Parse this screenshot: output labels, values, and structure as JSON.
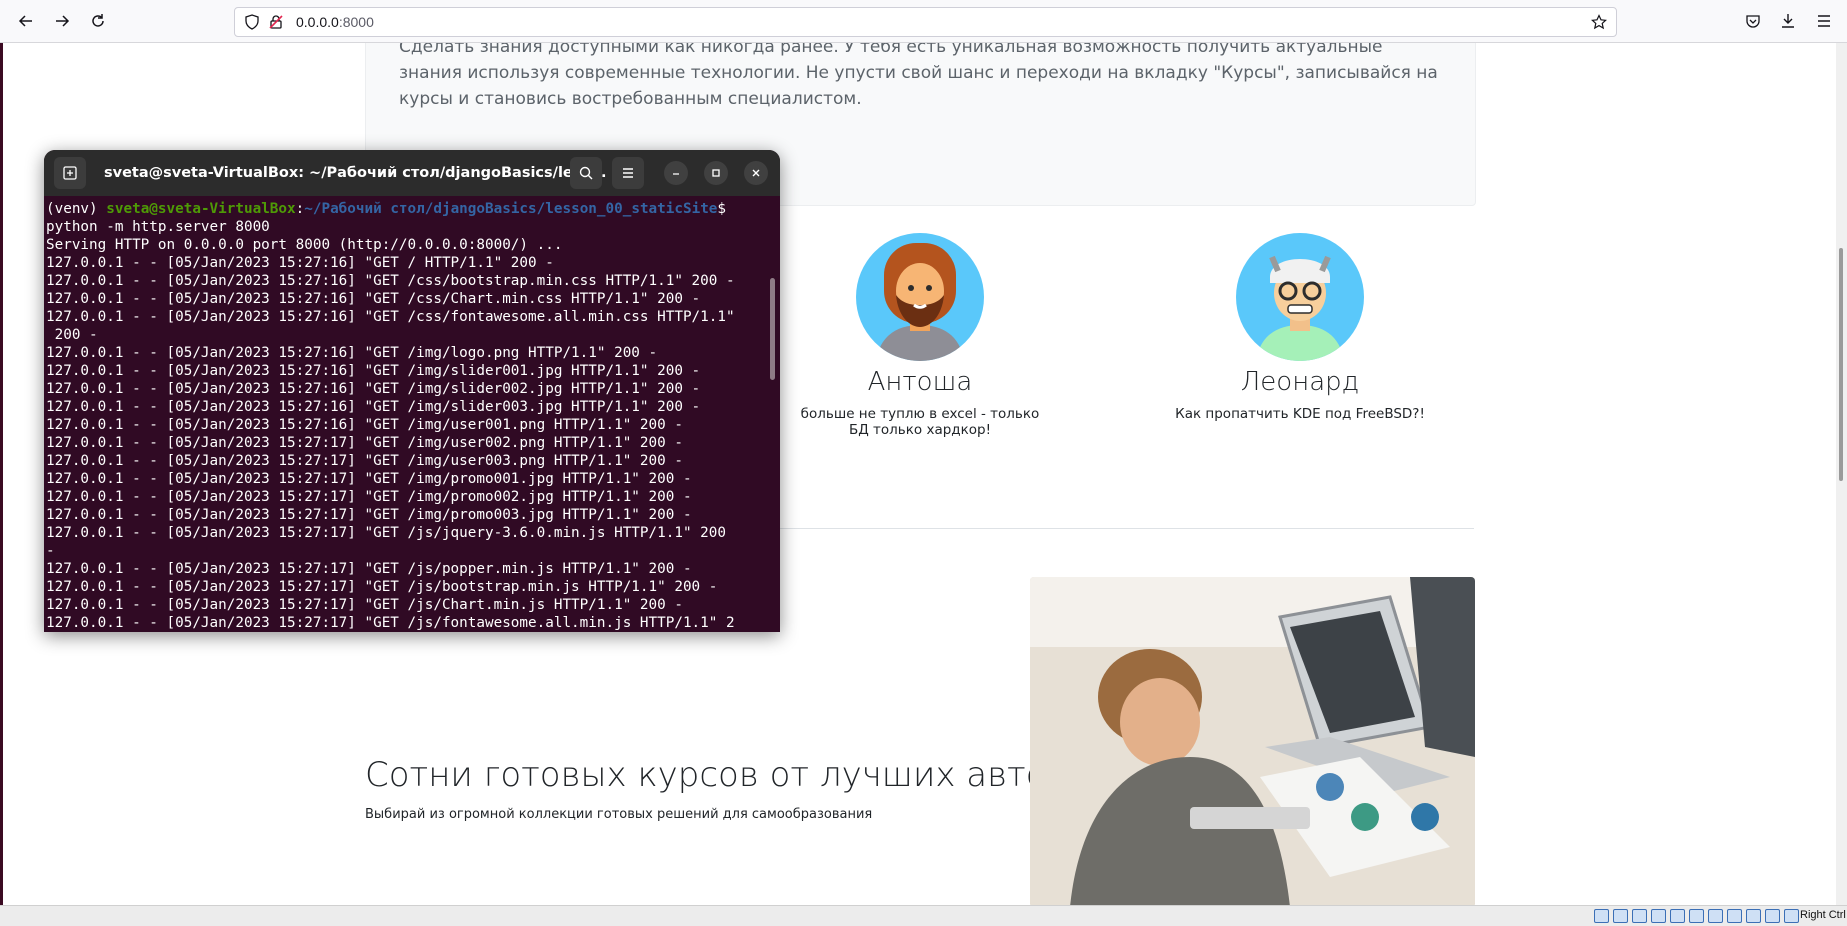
{
  "browser": {
    "url_host": "0.0.0.0",
    "url_port": ":8000"
  },
  "page": {
    "about_text": "Сделать знания доступными как никогда ранее. У тебя есть уникальная возможность получить актуальные знания используя современные технологии. Не упусти свой шанс и переходи на вкладку \"Курсы\", записывайся на курсы и становись востребованным специалистом.",
    "team": [
      {
        "name": "Антоша",
        "quote": "больше не туплю в excel - только БД только хардкор!"
      },
      {
        "name": "Леонард",
        "quote": "Как пропатчить KDE под FreeBSD?!"
      }
    ],
    "promo_title": "Сотни готовых курсов от лучших авторов",
    "promo_subtitle": "Выбирай из огромной коллекции готовых решений для самообразования"
  },
  "terminal": {
    "title": "sveta@sveta-VirtualBox: ~/Рабочий стол/djangoBasics/less...",
    "prompt_venv": "(venv) ",
    "prompt_user": "sveta@sveta-VirtualBox",
    "prompt_sep": ":",
    "prompt_path": "~/Рабочий стол/djangoBasics/lesson_00_staticSite",
    "prompt_end": "$",
    "lines": [
      "python -m http.server 8000",
      "Serving HTTP on 0.0.0.0 port 8000 (http://0.0.0.0:8000/) ...",
      "127.0.0.1 - - [05/Jan/2023 15:27:16] \"GET / HTTP/1.1\" 200 -",
      "127.0.0.1 - - [05/Jan/2023 15:27:16] \"GET /css/bootstrap.min.css HTTP/1.1\" 200 -",
      "127.0.0.1 - - [05/Jan/2023 15:27:16] \"GET /css/Chart.min.css HTTP/1.1\" 200 -",
      "127.0.0.1 - - [05/Jan/2023 15:27:16] \"GET /css/fontawesome.all.min.css HTTP/1.1\"",
      " 200 -",
      "127.0.0.1 - - [05/Jan/2023 15:27:16] \"GET /img/logo.png HTTP/1.1\" 200 -",
      "127.0.0.1 - - [05/Jan/2023 15:27:16] \"GET /img/slider001.jpg HTTP/1.1\" 200 -",
      "127.0.0.1 - - [05/Jan/2023 15:27:16] \"GET /img/slider002.jpg HTTP/1.1\" 200 -",
      "127.0.0.1 - - [05/Jan/2023 15:27:16] \"GET /img/slider003.jpg HTTP/1.1\" 200 -",
      "127.0.0.1 - - [05/Jan/2023 15:27:16] \"GET /img/user001.png HTTP/1.1\" 200 -",
      "127.0.0.1 - - [05/Jan/2023 15:27:17] \"GET /img/user002.png HTTP/1.1\" 200 -",
      "127.0.0.1 - - [05/Jan/2023 15:27:17] \"GET /img/user003.png HTTP/1.1\" 200 -",
      "127.0.0.1 - - [05/Jan/2023 15:27:17] \"GET /img/promo001.jpg HTTP/1.1\" 200 -",
      "127.0.0.1 - - [05/Jan/2023 15:27:17] \"GET /img/promo002.jpg HTTP/1.1\" 200 -",
      "127.0.0.1 - - [05/Jan/2023 15:27:17] \"GET /img/promo003.jpg HTTP/1.1\" 200 -",
      "127.0.0.1 - - [05/Jan/2023 15:27:17] \"GET /js/jquery-3.6.0.min.js HTTP/1.1\" 200",
      "-",
      "127.0.0.1 - - [05/Jan/2023 15:27:17] \"GET /js/popper.min.js HTTP/1.1\" 200 -",
      "127.0.0.1 - - [05/Jan/2023 15:27:17] \"GET /js/bootstrap.min.js HTTP/1.1\" 200 -",
      "127.0.0.1 - - [05/Jan/2023 15:27:17] \"GET /js/Chart.min.js HTTP/1.1\" 200 -",
      "127.0.0.1 - - [05/Jan/2023 15:27:17] \"GET /js/fontawesome.all.min.js HTTP/1.1\" 2"
    ]
  },
  "vbox": {
    "host_key": "Right Ctrl"
  },
  "icons": {
    "back": "back-arrow-icon",
    "forward": "forward-arrow-icon",
    "reload": "reload-icon",
    "shield": "tracking-shield-icon",
    "insecure": "insecure-lock-icon",
    "bookmark": "bookmark-star-icon",
    "pocket": "pocket-icon",
    "downloads": "downloads-icon",
    "menu": "hamburger-menu-icon",
    "new_tab": "new-tab-icon",
    "search": "search-icon",
    "close": "close-icon"
  }
}
